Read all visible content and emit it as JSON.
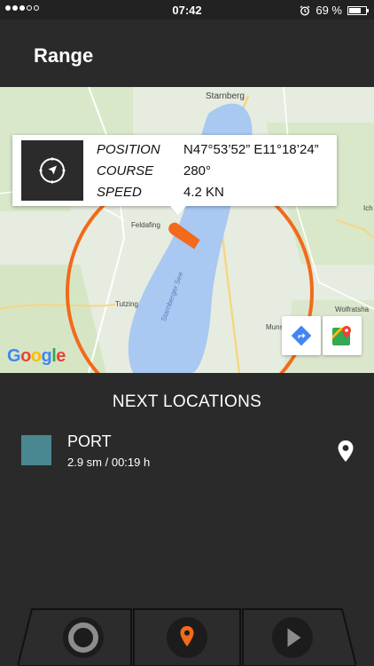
{
  "status_bar": {
    "time": "07:42",
    "battery_text": "69 %",
    "battery_level": 0.69
  },
  "header": {
    "title": "Range"
  },
  "map": {
    "attribution": "Google",
    "place_labels": [
      "Starnberg",
      "Feldafing",
      "Tutzing",
      "Starnberger See",
      "Wolfratsha",
      "Ich",
      "Muns"
    ],
    "accent_color": "#f26a1b",
    "water_color": "#a9c8f2"
  },
  "info_card": {
    "position_label": "POSITION",
    "position_value": "N47°53’52”  E11°18’24”",
    "course_label": "COURSE",
    "course_value": "280°",
    "speed_label": "SPEED",
    "speed_value": "4.2 KN"
  },
  "next_locations": {
    "title": "NEXT LOCATIONS",
    "items": [
      {
        "name": "PORT",
        "detail": "2.9 sm / 00:19 h",
        "color": "#4a8790"
      }
    ]
  },
  "bottom_nav": {
    "tabs": [
      {
        "icon": "circle-icon"
      },
      {
        "icon": "location-pin-icon",
        "active": true
      },
      {
        "icon": "play-icon"
      }
    ]
  }
}
